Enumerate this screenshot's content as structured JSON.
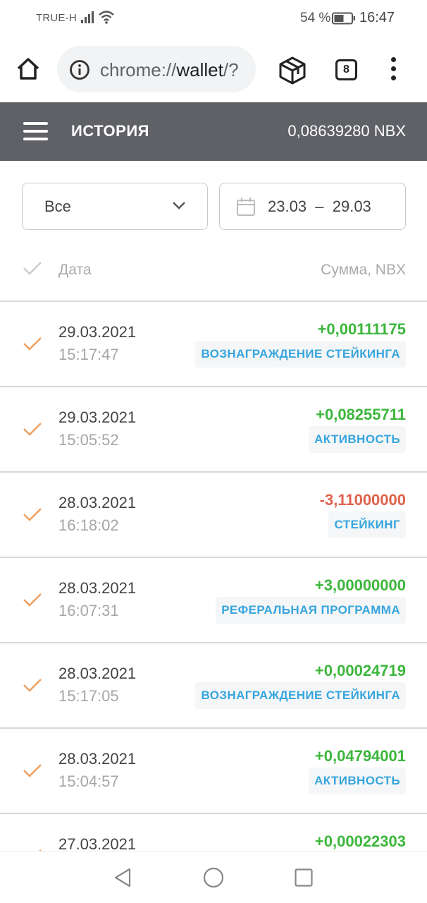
{
  "status_bar": {
    "carrier": "TRUE-H",
    "battery_percent": "54 %",
    "time": "16:47",
    "battery_level": 0.54
  },
  "browser": {
    "url_prefix": "chrome://",
    "url_host": "wallet",
    "url_rest": "/?",
    "tab_count": "8"
  },
  "header": {
    "title": "ИСТОРИЯ",
    "balance": "0,08639280 NBX"
  },
  "filters": {
    "type_selected": "Все",
    "date_range": "23.03  –  29.03"
  },
  "table": {
    "col_date": "Дата",
    "col_amount": "Сумма, NBX",
    "rows": [
      {
        "date": "29.03.2021",
        "time": "15:17:47",
        "amount": "+0,00111175",
        "sign": "pos",
        "tag": "ВОЗНАГРАЖДЕНИЕ СТЕЙКИНГА"
      },
      {
        "date": "29.03.2021",
        "time": "15:05:52",
        "amount": "+0,08255711",
        "sign": "pos",
        "tag": "АКТИВНОСТЬ"
      },
      {
        "date": "28.03.2021",
        "time": "16:18:02",
        "amount": "-3,11000000",
        "sign": "neg",
        "tag": "СТЕЙКИНГ"
      },
      {
        "date": "28.03.2021",
        "time": "16:07:31",
        "amount": "+3,00000000",
        "sign": "pos",
        "tag": "РЕФЕРАЛЬНАЯ ПРОГРАММА"
      },
      {
        "date": "28.03.2021",
        "time": "15:17:05",
        "amount": "+0,00024719",
        "sign": "pos",
        "tag": "ВОЗНАГРАЖДЕНИЕ СТЕЙКИНГА"
      },
      {
        "date": "28.03.2021",
        "time": "15:04:57",
        "amount": "+0,04794001",
        "sign": "pos",
        "tag": "АКТИВНОСТЬ"
      },
      {
        "date": "27.03.2021",
        "time": "",
        "amount": "+0,00022303",
        "sign": "pos",
        "tag": ""
      }
    ]
  },
  "colors": {
    "header_bg": "#5f6166",
    "positive": "#3cb63c",
    "negative": "#e0624c",
    "tag_text": "#36a5de",
    "check_orange": "#f0a060"
  },
  "icons": {
    "home": "home-icon",
    "info": "info-icon",
    "extension": "cube-icon",
    "menu": "more-vert-icon",
    "burger": "hamburger-menu-icon",
    "calendar": "calendar-icon",
    "chevron": "chevron-down-icon",
    "check": "checkmark-icon",
    "nav_back": "back-triangle-icon",
    "nav_home": "home-circle-icon",
    "nav_recent": "recent-square-icon"
  }
}
